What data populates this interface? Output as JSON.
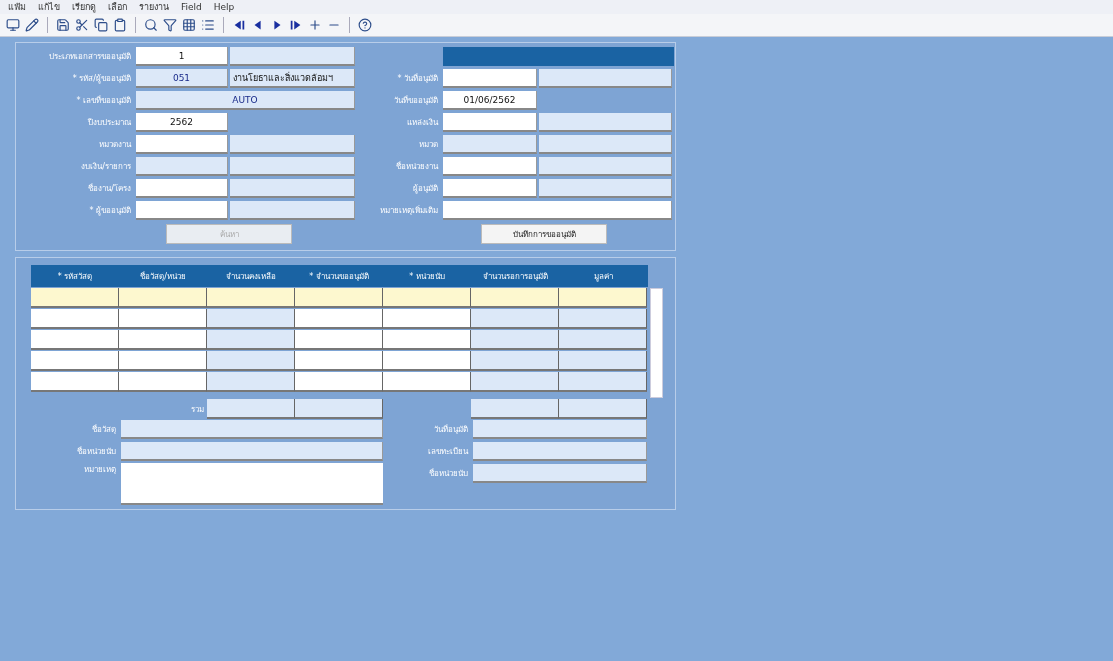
{
  "menu": [
    "แฟ้ม",
    "แก้ไข",
    "เรียกดู",
    "เลือก",
    "รายงาน",
    "Field",
    "Help"
  ],
  "toolbar": [
    {
      "kind": "monitor"
    },
    {
      "kind": "pencil"
    },
    {
      "kind": "sep"
    },
    {
      "kind": "save"
    },
    {
      "kind": "cut"
    },
    {
      "kind": "copy"
    },
    {
      "kind": "paste"
    },
    {
      "kind": "sep"
    },
    {
      "kind": "search"
    },
    {
      "kind": "filter"
    },
    {
      "kind": "grid"
    },
    {
      "kind": "list"
    },
    {
      "kind": "sep"
    },
    {
      "kind": "first"
    },
    {
      "kind": "prev"
    },
    {
      "kind": "next"
    },
    {
      "kind": "last"
    },
    {
      "kind": "add"
    },
    {
      "kind": "remove"
    },
    {
      "kind": "sep"
    },
    {
      "kind": "help"
    }
  ],
  "header_left": [
    {
      "label": "ประเภทเอกสารขออนุมัติ",
      "fields": [
        {
          "value": "1",
          "editable": true
        },
        {
          "editable": false
        }
      ]
    },
    {
      "label": "* รหัส/ผู้ขออนุมัติ",
      "fields": [
        {
          "value": "051",
          "editable": false
        },
        {
          "value": "งานโยธาและสิ่งแวดล้อมฯ",
          "editable": false
        }
      ]
    },
    {
      "label": "* เลขที่ขออนุมัติ",
      "fields": [
        {
          "value": "AUTO",
          "editable": false,
          "wide": true
        }
      ]
    },
    {
      "label": "ปีงบประมาณ",
      "fields": [
        {
          "value": "2562",
          "editable": true
        }
      ]
    },
    {
      "label": "หมวดงาน",
      "fields": [
        {
          "editable": true
        },
        {
          "editable": false
        }
      ]
    },
    {
      "label": "งบเงิน/รายการ",
      "fields": [
        {
          "editable": false
        },
        {
          "editable": false
        }
      ]
    },
    {
      "label": "ชื่องาน/โครง",
      "fields": [
        {
          "editable": true
        },
        {
          "editable": false
        }
      ]
    },
    {
      "label": "* ผู้ขออนุมัติ",
      "fields": [
        {
          "editable": true
        },
        {
          "editable": false
        }
      ]
    }
  ],
  "header_right": [
    {
      "label": "* วันที่อนุมัติ",
      "fields": [
        {
          "editable": true
        },
        {
          "editable": false
        }
      ]
    },
    {
      "label": "วันที่ขออนุมัติ",
      "fields": [
        {
          "value": "01/06/2562",
          "editable": true
        }
      ]
    },
    {
      "label": "แหล่งเงิน",
      "fields": [
        {
          "editable": true
        },
        {
          "editable": false
        }
      ]
    },
    {
      "label": "หมวด",
      "fields": [
        {
          "editable": false
        },
        {
          "editable": false
        }
      ]
    },
    {
      "label": "ชื่อหน่วยงาน",
      "fields": [
        {
          "editable": true
        },
        {
          "editable": false
        }
      ]
    },
    {
      "label": "ผู้อนุมัติ",
      "fields": [
        {
          "editable": true
        },
        {
          "editable": false
        }
      ]
    },
    {
      "label": "หมายเหตุเพิ่มเติม",
      "fields": [
        {
          "editable": true,
          "wide": true
        }
      ]
    }
  ],
  "buttons": [
    {
      "label": "ค้นหา",
      "disabled": true
    },
    {
      "label": "บันทึกการขออนุมัติ",
      "disabled": false
    }
  ],
  "table": {
    "columns": [
      {
        "label": "* รหัสวัสดุ",
        "editable": true
      },
      {
        "label": "ชื่อวัสดุ/หน่วย",
        "editable": true
      },
      {
        "label": "จำนวนคงเหลือ",
        "editable": false
      },
      {
        "label": "* จำนวนขออนุมัติ",
        "editable": true
      },
      {
        "label": "* หน่วยนับ",
        "editable": true
      },
      {
        "label": "จำนวนรอการอนุมัติ",
        "editable": false
      },
      {
        "label": "มูลค่า",
        "editable": false
      }
    ],
    "rows": [
      {
        "selected": true
      },
      {
        "selected": false
      },
      {
        "selected": false
      },
      {
        "selected": false
      },
      {
        "selected": false
      }
    ],
    "total_label": "รวม"
  },
  "footer_left": [
    {
      "label": "ชื่อวัสดุ",
      "kind": "line"
    },
    {
      "label": "ชื่อหน่วยนับ",
      "kind": "line"
    },
    {
      "label": "หมายเหตุ",
      "kind": "memo"
    }
  ],
  "footer_right": [
    {
      "label": "วันที่อนุมัติ"
    },
    {
      "label": "เลขทะเบียน"
    },
    {
      "label": "ชื่อหน่วยนับ"
    }
  ]
}
